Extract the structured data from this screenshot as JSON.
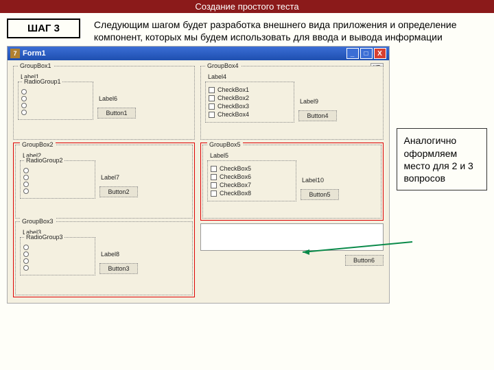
{
  "header": {
    "title": "Создание простого теста"
  },
  "step": {
    "label": "ШАГ 3"
  },
  "description": "Следующим шагом будет разработка внешнего вида приложения и определение компонент, которых мы будем использовать для ввода и вывода информации",
  "note": "Аналогично оформляем место для 2 и 3 вопросов",
  "form": {
    "title": "Form1",
    "xp": "XP",
    "win_min": "_",
    "win_max": "□",
    "win_close": "X"
  },
  "left": {
    "g1": {
      "caption": "GroupBox1",
      "label": "Label1",
      "radio": "RadioGroup1",
      "sideLabel": "Label6",
      "button": "Button1"
    },
    "g2": {
      "caption": "GroupBox2",
      "label": "Label2",
      "radio": "RadioGroup2",
      "sideLabel": "Label7",
      "button": "Button2"
    },
    "g3": {
      "caption": "GroupBox3",
      "label": "Label3",
      "radio": "RadioGroup3",
      "sideLabel": "Label8",
      "button": "Button3"
    }
  },
  "right": {
    "g4": {
      "caption": "GroupBox4",
      "label": "Label4",
      "c1": "CheckBox1",
      "c2": "CheckBox2",
      "c3": "CheckBox3",
      "c4": "CheckBox4",
      "sideLabel": "Label9",
      "button": "Button4"
    },
    "g5": {
      "caption": "GroupBox5",
      "label": "Label5",
      "c1": "CheckBox5",
      "c2": "CheckBox6",
      "c3": "CheckBox7",
      "c4": "CheckBox8",
      "sideLabel": "Label10",
      "button": "Button5"
    },
    "g6": {
      "button": "Button6"
    }
  }
}
